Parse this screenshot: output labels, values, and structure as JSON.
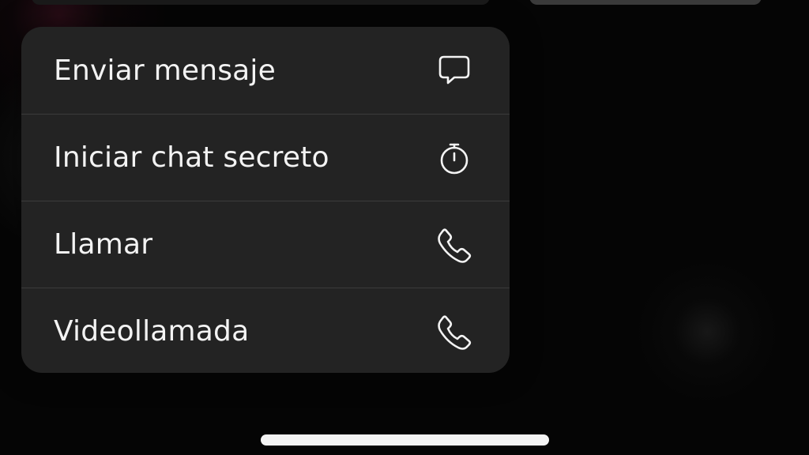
{
  "context_menu": {
    "items": [
      {
        "label": "Enviar mensaje",
        "icon": "chat-bubble-icon"
      },
      {
        "label": "Iniciar chat secreto",
        "icon": "timer-icon"
      },
      {
        "label": "Llamar",
        "icon": "phone-icon"
      },
      {
        "label": "Videollamada",
        "icon": "phone-icon"
      }
    ]
  }
}
